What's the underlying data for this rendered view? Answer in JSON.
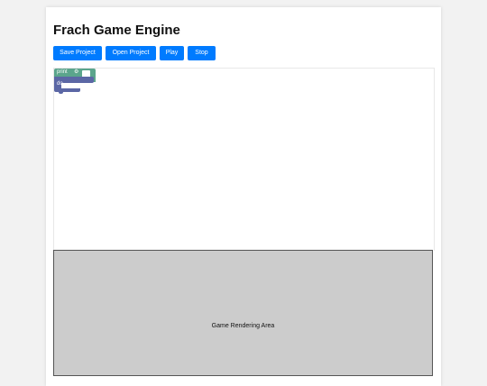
{
  "app": {
    "title": "Frach Game Engine"
  },
  "toolbar": {
    "save_label": "Save Project",
    "open_label": "Open Project",
    "play_label": "Play",
    "stop_label": "Stop"
  },
  "workspace": {
    "blocks": {
      "print_label": "print",
      "do_label": "do"
    }
  },
  "render": {
    "label": "Game Rendering Area"
  },
  "colors": {
    "page_bg": "#f2f2f2",
    "panel_bg": "#ffffff",
    "button_bg": "#007bff",
    "button_text": "#ffffff",
    "block_print": "#5ba58c",
    "block_io": "#5b67a5",
    "render_bg": "#cccccc",
    "render_border": "#555555"
  },
  "icons": {
    "gear": "gear-icon"
  }
}
